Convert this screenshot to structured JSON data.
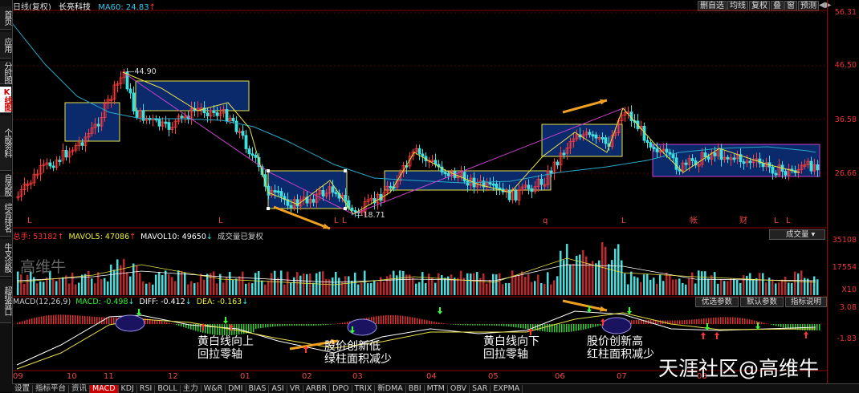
{
  "header": {
    "chart_title": "日线(复权)",
    "stock_name": "长亮科技",
    "ma_label": "MA60: 24.83",
    "ma_arrow": "↑",
    "tools": [
      "删自选",
      "均线",
      "复权",
      "叠",
      "窗",
      "预测"
    ]
  },
  "sidebar": {
    "items": [
      "首页",
      "应用",
      "分时图",
      "K线图",
      "个股资料",
      "自选股",
      "综合排名",
      "牛叉诊股",
      "超级盘口"
    ],
    "active_index": 3
  },
  "price_axis": [
    "56.31",
    "46.50",
    "36.58",
    "26.66"
  ],
  "price_annotations": {
    "high": "44.90",
    "low": "18.71"
  },
  "event_markers": [
    "L",
    "L",
    "L",
    "L",
    "q",
    "L",
    "帐",
    "财",
    "L",
    "L"
  ],
  "volume_panel": {
    "hand": "总手: 53182",
    "mavol5": "MAVOL5: 47086",
    "mavol10": "MAVOL10: 49650",
    "status": "成交量已复权",
    "indicator_select": "成交量",
    "axis": [
      "35108",
      "17554",
      "X10"
    ],
    "watermark": "高维牛"
  },
  "macd_panel": {
    "name": "MACD(12,26,9)",
    "macd": "MACD: -0.498",
    "diff": "DIFF: -0.412",
    "dea": "DEA: -0.163",
    "buttons": [
      "优选参数",
      "默认参数",
      "指标说明"
    ],
    "axis": [
      "3.08",
      "-1.83"
    ]
  },
  "x_axis": [
    "09",
    "10",
    "11",
    "12",
    "01",
    "02",
    "03",
    "04",
    "05",
    "06",
    "07",
    "08"
  ],
  "annotations": [
    {
      "text": "黄白线向上\n回拉零轴"
    },
    {
      "text": "股价创新低\n绿柱面积减少"
    },
    {
      "text": "黄白线向下\n回拉零轴"
    },
    {
      "text": "股价创新高\n红柱面积减少"
    }
  ],
  "bottom_tabs": [
    "设置",
    "指标平台",
    "资讯",
    "MACD",
    "KDJ",
    "RSI",
    "BOLL",
    "主力",
    "W&R",
    "DMI",
    "BIAS",
    "ASI",
    "VR",
    "ARBR",
    "DPO",
    "TRIX",
    "新DMA",
    "BBI",
    "MTM",
    "OBV",
    "SAR",
    "EXPMA"
  ],
  "active_tab": "MACD",
  "watermark": "天涯社区@高维牛",
  "colors": {
    "up": "#ff3b3b",
    "down": "#3fe0e0",
    "ma": "#2aa8c8",
    "yellow": "#e8e04a",
    "magenta": "#d040d0",
    "box": "#0b2a6b"
  }
}
